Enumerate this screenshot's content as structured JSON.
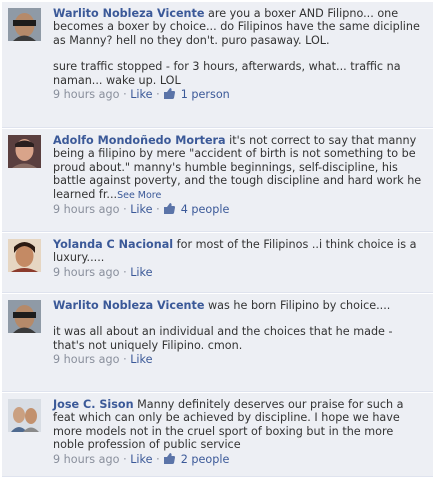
{
  "comments": [
    {
      "author": "Warlito Nobleza Vicente",
      "text": "are you a boxer AND Filipno... one becomes a boxer by choice... do Filipinos have the same dicipline as Manny? hell no they don't. puro pasaway. LOL.",
      "text2": "sure traffic stopped - for 3 hours, afterwards, what... traffic na naman... wake up. LOL",
      "time": "9 hours ago",
      "sep": "·",
      "like": "Like",
      "likes": "1 person"
    },
    {
      "author": "Adolfo Mondoñedo Mortera",
      "text": "it's not correct to say that manny being a filipino by mere \"accident of birth is not something to be proud about.\" manny's humble beginnings, self-discipline, his battle against poverty, and the tough discipline and hard work he learned fr...",
      "see_more": "See More",
      "time": "9 hours ago",
      "sep": "·",
      "like": "Like",
      "likes": "4 people"
    },
    {
      "author": "Yolanda C Nacional",
      "text": "for most of the Filipinos ..i think choice is a luxury.....",
      "time": "9 hours ago",
      "sep": "·",
      "like": "Like"
    },
    {
      "author": "Warlito Nobleza Vicente",
      "text": "was he born Filipino by choice....",
      "text2": "it was all about an individual and the choices that he made - that's not uniquely Filipino. cmon.",
      "time": "9 hours ago",
      "sep": "·",
      "like": "Like"
    },
    {
      "author": "Jose C. Sison",
      "text": "Manny definitely deserves our praise for such a feat which can only be achieved by discipline. I hope we have more models not in the cruel sport of boxing but in the more noble profession of public service",
      "time": "9 hours ago",
      "sep": "·",
      "like": "Like",
      "likes": "2 people"
    }
  ]
}
